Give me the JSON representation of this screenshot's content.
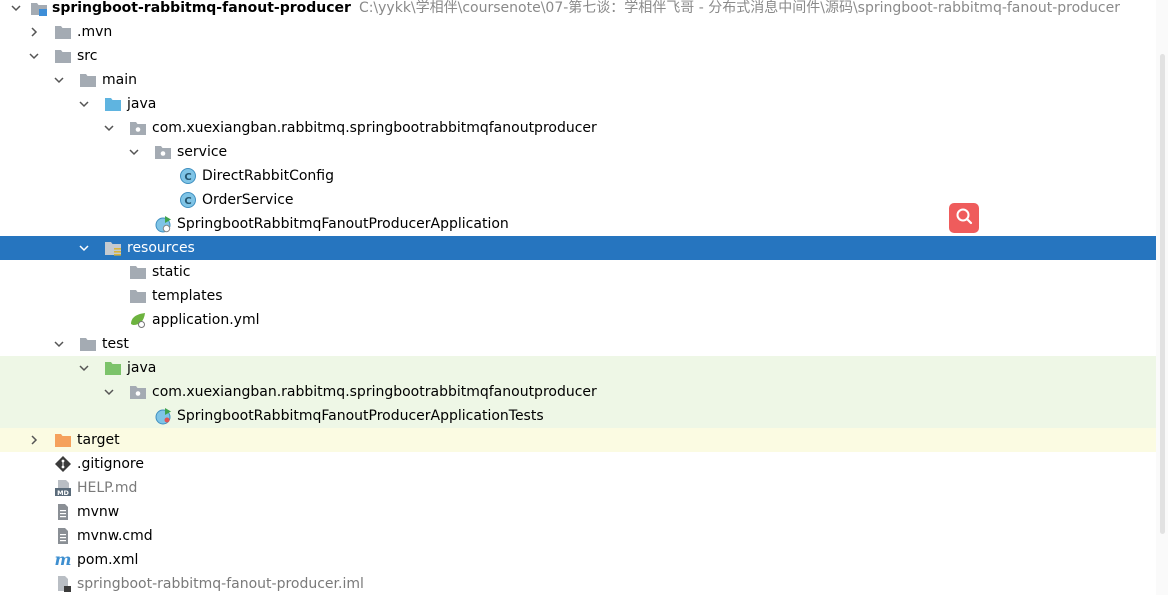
{
  "project": {
    "name": "springboot-rabbitmq-fanout-producer",
    "path": "C:\\yykk\\学相伴\\coursenote\\07-第七谈：学相伴飞哥 - 分布式消息中间件\\源码\\springboot-rabbitmq-fanout-producer"
  },
  "tree": {
    "mvn": ".mvn",
    "src": "src",
    "main": "main",
    "main_java": "java",
    "main_pkg": "com.xuexiangban.rabbitmq.springbootrabbitmqfanoutproducer",
    "service": "service",
    "direct_config": "DirectRabbitConfig",
    "order_service": "OrderService",
    "app_class": "SpringbootRabbitmqFanoutProducerApplication",
    "resources": "resources",
    "static": "static",
    "templates": "templates",
    "app_yml": "application.yml",
    "test": "test",
    "test_java": "java",
    "test_pkg": "com.xuexiangban.rabbitmq.springbootrabbitmqfanoutproducer",
    "app_tests": "SpringbootRabbitmqFanoutProducerApplicationTests",
    "target": "target",
    "gitignore": ".gitignore",
    "help_md": "HELP.md",
    "mvnw": "mvnw",
    "mvnw_cmd": "mvnw.cmd",
    "pom": "pom.xml",
    "iml": "springboot-rabbitmq-fanout-producer.iml"
  },
  "icons": {
    "md_badge": "MD",
    "class_badge": "C",
    "maven_m": "m"
  },
  "colors": {
    "selection": "#2675bf",
    "test_bg": "#eef7e6",
    "excluded_bg": "#fbfbe2",
    "folder_grey": "#a4abb3",
    "folder_blue": "#5fb4e0",
    "folder_green": "#7cc36a",
    "folder_orange": "#f5a15c",
    "search_float": "#ef5c5c"
  }
}
